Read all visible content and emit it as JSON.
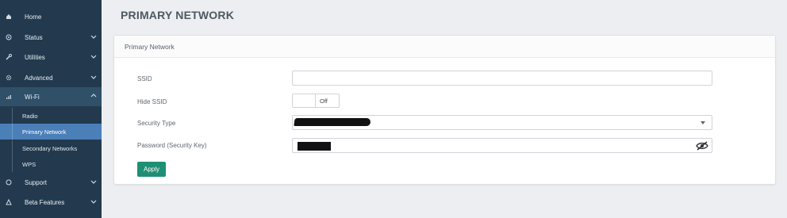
{
  "sidebar": {
    "items": [
      {
        "label": "Home",
        "icon": "home-icon"
      },
      {
        "label": "Status",
        "icon": "status-icon"
      },
      {
        "label": "Utilities",
        "icon": "wrench-icon"
      },
      {
        "label": "Advanced",
        "icon": "gear-icon"
      },
      {
        "label": "Wi-Fi",
        "icon": "wifi-icon"
      }
    ],
    "wifi_sub": [
      {
        "label": "Radio"
      },
      {
        "label": "Primary Network"
      },
      {
        "label": "Secondary Networks"
      },
      {
        "label": "WPS"
      }
    ],
    "bottom_items": [
      {
        "label": "Support",
        "icon": "support-icon"
      },
      {
        "label": "Beta Features",
        "icon": "warning-icon"
      }
    ]
  },
  "page": {
    "title": "PRIMARY NETWORK"
  },
  "card": {
    "title": "Primary Network",
    "ssid_label": "SSID",
    "ssid_value": "",
    "hide_ssid_label": "Hide SSID",
    "hide_ssid_state": "Off",
    "security_type_label": "Security Type",
    "password_label": "Password (Security Key)",
    "apply_label": "Apply"
  },
  "colors": {
    "sidebar_bg": "#233a4e",
    "sidebar_active": "#4b7fb8",
    "apply_button": "#1e8f74",
    "page_bg": "#eceef1"
  }
}
